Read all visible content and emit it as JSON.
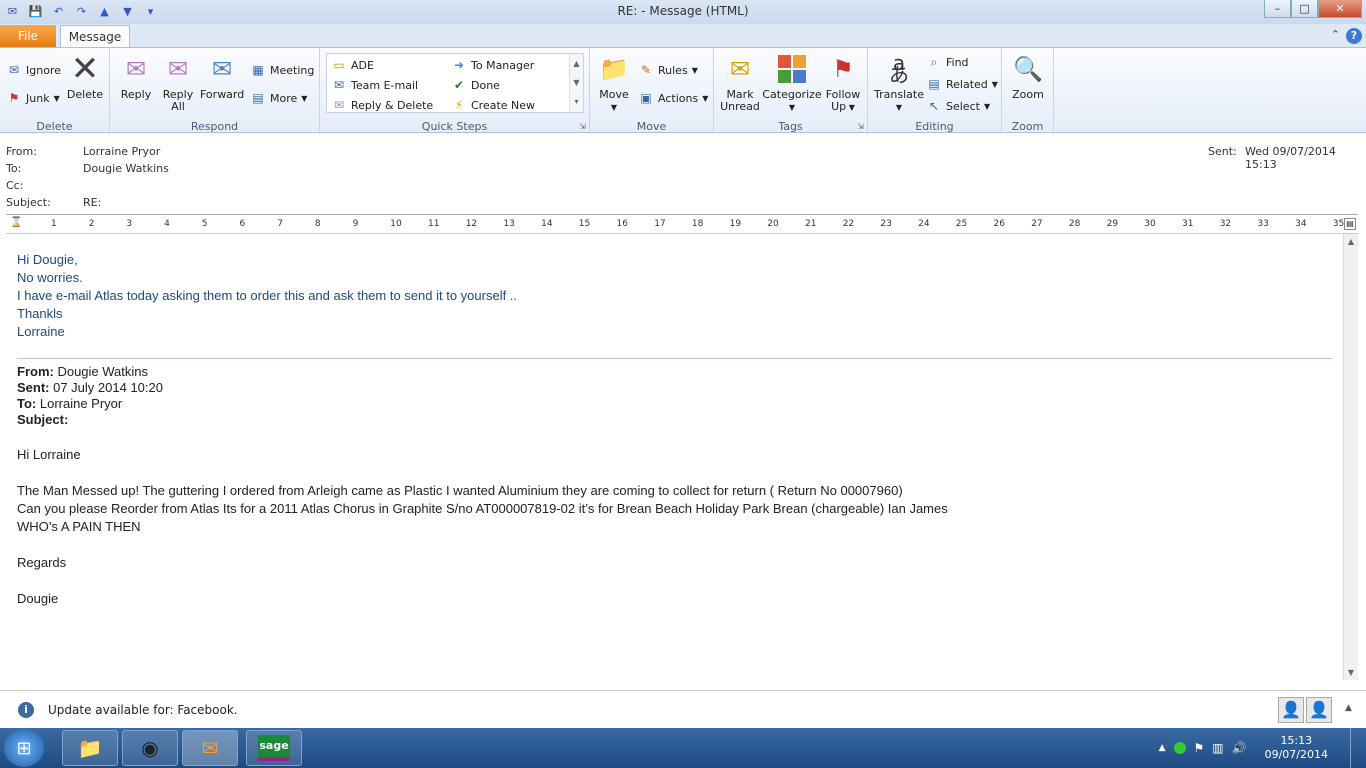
{
  "window": {
    "title": "RE:  -  Message (HTML)",
    "controls": {
      "minimize": "–",
      "maximize": "□",
      "close": "✕"
    }
  },
  "tabs": {
    "file": "File",
    "message": "Message"
  },
  "ribbon": {
    "delete": {
      "label": "Delete",
      "ignore": "Ignore",
      "junk": "Junk",
      "delete_btn": "Delete"
    },
    "respond": {
      "label": "Respond",
      "reply": "Reply",
      "reply_all_1": "Reply",
      "reply_all_2": "All",
      "forward": "Forward",
      "meeting": "Meeting",
      "more": "More"
    },
    "quick_steps": {
      "label": "Quick Steps",
      "items": [
        "ADE",
        "Team E-mail",
        "Reply & Delete",
        "To Manager",
        "Done",
        "Create New"
      ]
    },
    "move": {
      "label": "Move",
      "move_btn": "Move",
      "rules": "Rules",
      "actions": "Actions"
    },
    "tags": {
      "label": "Tags",
      "mark_unread_1": "Mark",
      "mark_unread_2": "Unread",
      "categorize": "Categorize",
      "follow_up_1": "Follow",
      "follow_up_2": "Up"
    },
    "editing": {
      "label": "Editing",
      "translate": "Translate",
      "find": "Find",
      "related": "Related",
      "select": "Select"
    },
    "zoom": {
      "label": "Zoom",
      "zoom_btn": "Zoom"
    }
  },
  "header": {
    "from_label": "From:",
    "from_value": "Lorraine Pryor",
    "to_label": "To:",
    "to_value": "Dougie Watkins",
    "cc_label": "Cc:",
    "subject_label": "Subject:",
    "subject_value": "RE:",
    "sent_label": "Sent:",
    "sent_value": "Wed 09/07/2014 15:13"
  },
  "ruler": [
    "1",
    "2",
    "3",
    "4",
    "5",
    "6",
    "7",
    "8",
    "9",
    "10",
    "11",
    "12",
    "13",
    "14",
    "15",
    "16",
    "17",
    "18",
    "19",
    "20",
    "21",
    "22",
    "23",
    "24",
    "25",
    "26",
    "27",
    "28",
    "29",
    "30",
    "31",
    "32",
    "33",
    "34",
    "35"
  ],
  "reply": {
    "lines": [
      "Hi Dougie,",
      "No worries.",
      "I have e-mail Atlas today asking them to order this and ask them to send it to yourself ..",
      "Thankls",
      "Lorraine"
    ]
  },
  "original": {
    "from_label": "From:",
    "from_value": " Dougie Watkins",
    "sent_label": "Sent:",
    "sent_value": " 07 July 2014 10:20",
    "to_label": "To:",
    "to_value": " Lorraine Pryor",
    "subject_label": "Subject:",
    "greeting": "Hi  Lorraine",
    "para1": "The Man Messed up! The guttering I ordered from Arleigh came as Plastic I wanted Aluminium they are coming to collect for return ( Return No 00007960)",
    "para2": "Can you please Reorder from Atlas Its for a 2011 Atlas Chorus in Graphite S/no AT000007819-02 it’s for Brean Beach Holiday Park Brean (chargeable) Ian James",
    "para3": "WHO’s A PAIN THEN",
    "regards": "Regards",
    "signature": "Dougie"
  },
  "status": {
    "message": "Update available for: Facebook."
  },
  "taskbar": {
    "time": "15:13",
    "date": "09/07/2014",
    "sage": "sage"
  }
}
